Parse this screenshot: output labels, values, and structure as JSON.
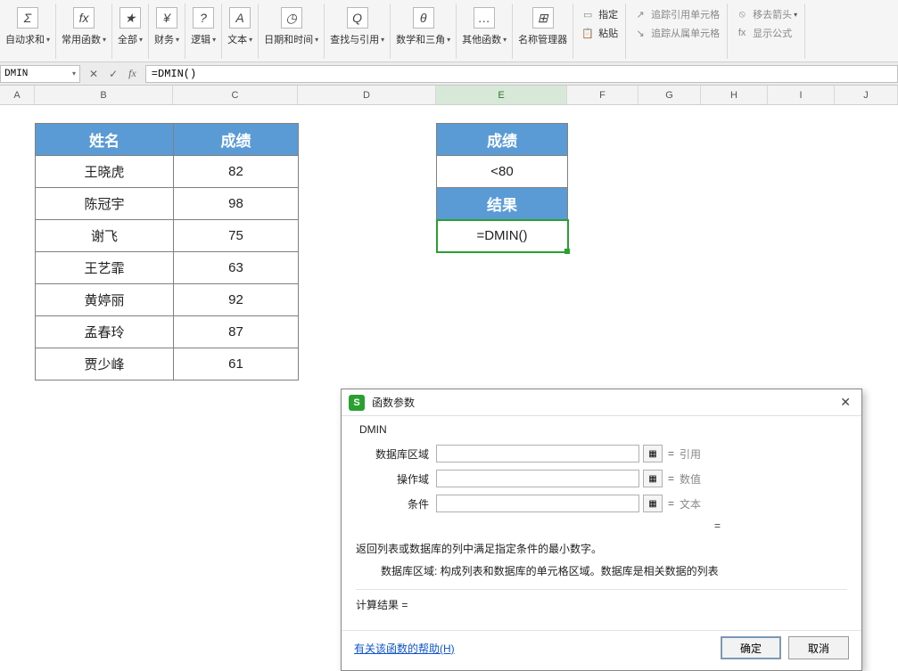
{
  "ribbon": {
    "autosum": {
      "icon": "Σ",
      "label": "自动求和"
    },
    "common_fn": {
      "icon": "fx",
      "label": "常用函数"
    },
    "all": {
      "icon": "★",
      "label": "全部"
    },
    "finance": {
      "icon": "¥",
      "label": "财务"
    },
    "logic": {
      "icon": "?",
      "label": "逻辑"
    },
    "text": {
      "icon": "A",
      "label": "文本"
    },
    "datetime": {
      "icon": "◷",
      "label": "日期和时间"
    },
    "lookup": {
      "icon": "Q",
      "label": "查找与引用"
    },
    "math": {
      "icon": "θ",
      "label": "数学和三角"
    },
    "other": {
      "icon": "…",
      "label": "其他函数"
    },
    "name_mgr": {
      "icon": "⊞",
      "label": "名称管理器"
    },
    "right": {
      "define": "指定",
      "paste": "粘贴",
      "trace_precedents": "追踪引用单元格",
      "trace_dependents": "追踪从属单元格",
      "remove_arrows": "移去箭头",
      "show_formulas": "显示公式"
    }
  },
  "formula_bar": {
    "name_box": "DMIN",
    "formula": "=DMIN()"
  },
  "columns": [
    "A",
    "B",
    "C",
    "D",
    "E",
    "F",
    "G",
    "H",
    "I",
    "J"
  ],
  "active_column": "E",
  "table": {
    "headers": {
      "name": "姓名",
      "score": "成绩"
    },
    "rows": [
      {
        "name": "王晓虎",
        "score": "82"
      },
      {
        "name": "陈冠宇",
        "score": "98"
      },
      {
        "name": "谢飞",
        "score": "75"
      },
      {
        "name": "王艺霏",
        "score": "63"
      },
      {
        "name": "黄婷丽",
        "score": "92"
      },
      {
        "name": "孟春玲",
        "score": "87"
      },
      {
        "name": "贾少峰",
        "score": "61"
      }
    ]
  },
  "criteria": {
    "header1": "成绩",
    "value1": "<80",
    "header2": "结果",
    "value2": "=DMIN()"
  },
  "dialog": {
    "title": "函数参数",
    "fn_name": "DMIN",
    "params": {
      "database": {
        "label": "数据库区域",
        "hint": "引用"
      },
      "field": {
        "label": "操作域",
        "hint": "数值"
      },
      "criteria": {
        "label": "条件",
        "hint": "文本"
      }
    },
    "result_eq": "=",
    "eq_sign": "=",
    "description": "返回列表或数据库的列中满足指定条件的最小数字。",
    "param_desc": "数据库区域:  构成列表和数据库的单元格区域。数据库是相关数据的列表",
    "calc_result_label": "计算结果 =",
    "help_link": "有关该函数的帮助(H)",
    "ok": "确定",
    "cancel": "取消"
  }
}
